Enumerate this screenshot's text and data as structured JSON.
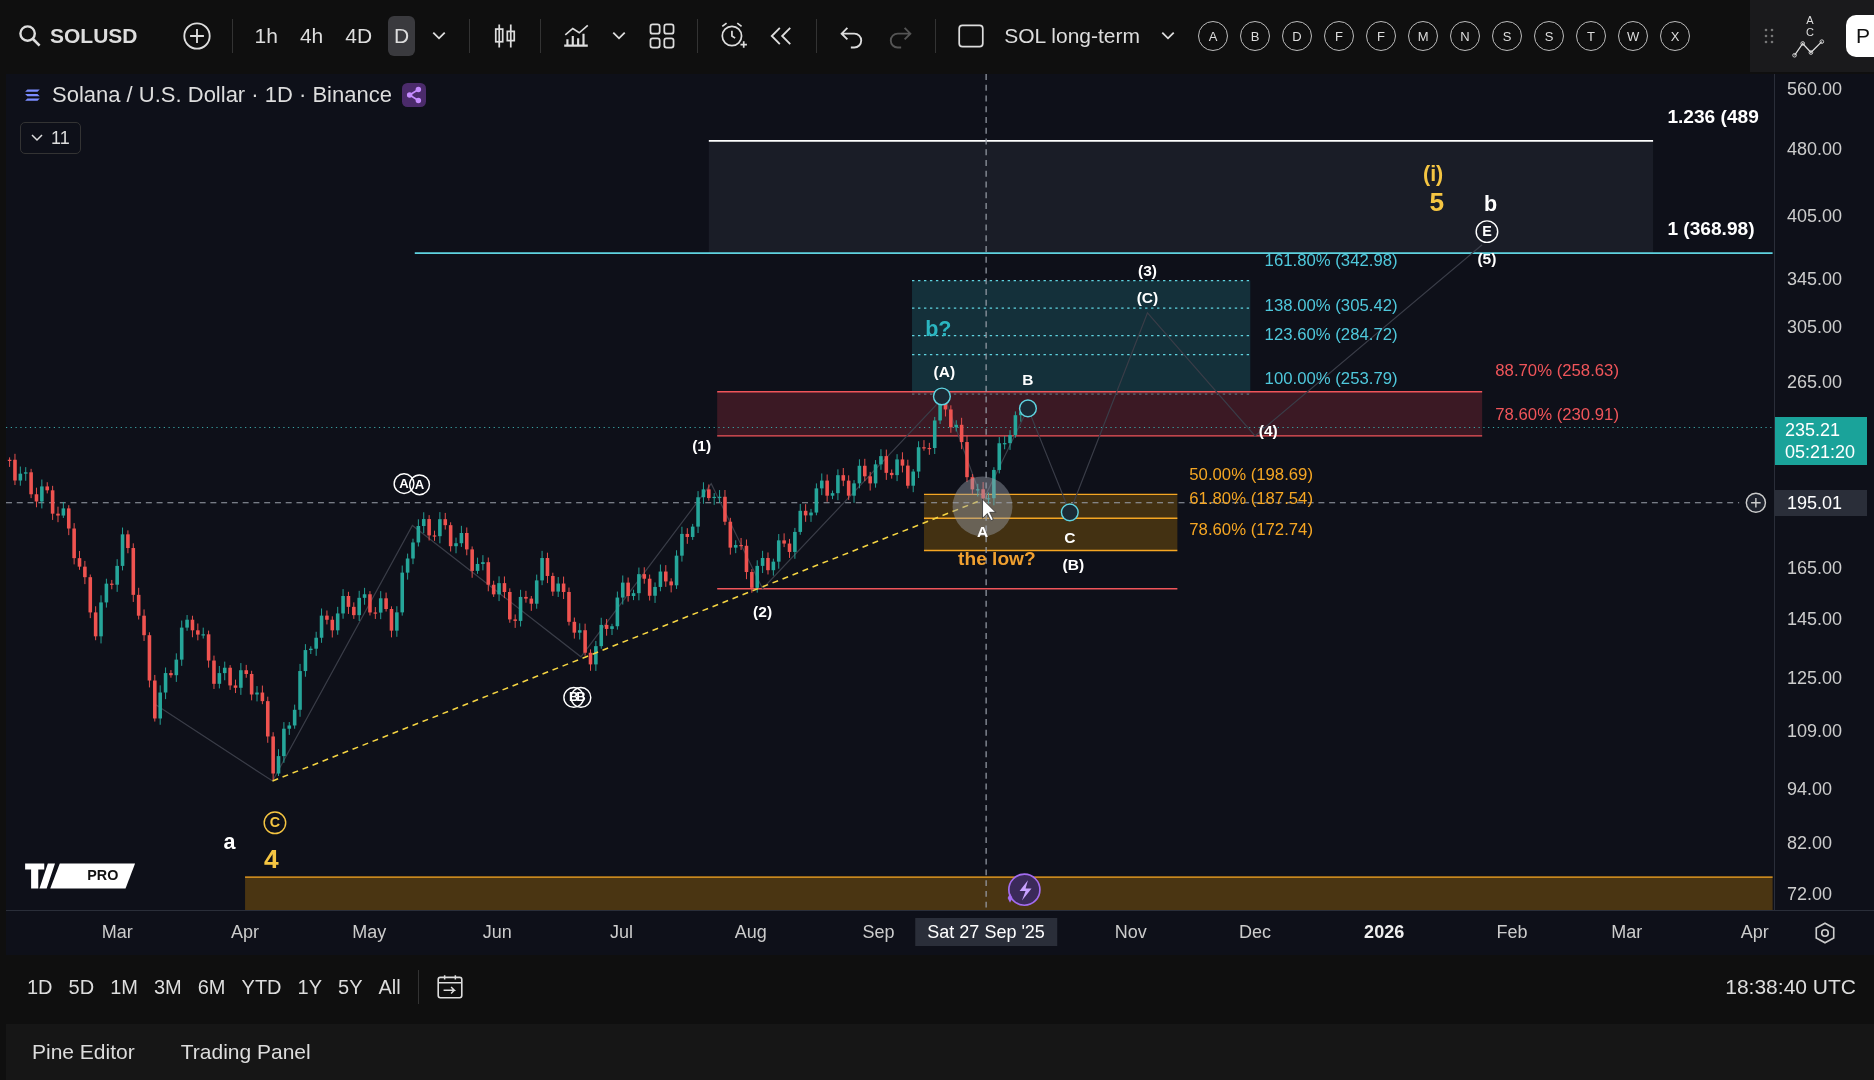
{
  "toolbar": {
    "symbol": "SOLUSD",
    "intervals": [
      {
        "label": "1h",
        "selected": false
      },
      {
        "label": "4h",
        "selected": false
      },
      {
        "label": "4D",
        "selected": false
      },
      {
        "label": "D",
        "selected": true
      }
    ],
    "history": [
      {
        "kind": "undo",
        "disabled": false
      },
      {
        "kind": "redo",
        "disabled": true
      }
    ],
    "layout_name": "SOL long-term",
    "letter_buttons": [
      "A",
      "B",
      "D",
      "F",
      "F",
      "M",
      "N",
      "S",
      "S",
      "T",
      "W",
      "X"
    ],
    "pattern_tool": "A C",
    "edge_button": "P"
  },
  "legend": {
    "title": "Solana / U.S. Dollar · 1D · Binance",
    "indicator_count": "11"
  },
  "chart": {
    "fib_labels": [
      {
        "text": "1.236 (489",
        "color": "#ffffff"
      },
      {
        "text": "1 (368.98)",
        "color": "#ffffff"
      },
      {
        "text": "161.80% (342.98)",
        "color": "#4fc8dc"
      },
      {
        "text": "138.00% (305.42)",
        "color": "#4fc8dc"
      },
      {
        "text": "123.60% (284.72)",
        "color": "#4fc8dc"
      },
      {
        "text": "100.00% (253.79)",
        "color": "#4fc8dc"
      },
      {
        "text": "88.70% (258.63)",
        "color": "#f0555a"
      },
      {
        "text": "78.60% (230.91)",
        "color": "#f0555a"
      },
      {
        "text": "50.00% (198.69)",
        "color": "#f5a623"
      },
      {
        "text": "61.80% (187.54)",
        "color": "#f5a623"
      },
      {
        "text": "78.60% (172.74)",
        "color": "#f5a623"
      }
    ],
    "wave_labels": [
      {
        "text": "(i)",
        "kind": "plain",
        "color": "#f5c542"
      },
      {
        "text": "5",
        "kind": "plain",
        "color": "#f5c542"
      },
      {
        "text": "b",
        "kind": "plain",
        "color": "#ffffff"
      },
      {
        "text": "E",
        "kind": "circled",
        "color": "#ffffff"
      },
      {
        "text": "(5)",
        "kind": "plain",
        "color": "#ffffff"
      },
      {
        "text": "(3)",
        "kind": "plain",
        "color": "#ffffff"
      },
      {
        "text": "(C)",
        "kind": "plain",
        "color": "#ffffff"
      },
      {
        "text": "b?",
        "kind": "plain",
        "color": "#2bb5c0"
      },
      {
        "text": "(A)",
        "kind": "plain",
        "color": "#ffffff"
      },
      {
        "text": "B",
        "kind": "plain",
        "color": "#ffffff"
      },
      {
        "text": "(1)",
        "kind": "plain",
        "color": "#ffffff"
      },
      {
        "text": "(4)",
        "kind": "plain",
        "color": "#ffffff"
      },
      {
        "text": "A",
        "kind": "plain",
        "color": "#ffffff"
      },
      {
        "text": "C",
        "kind": "plain",
        "color": "#ffffff"
      },
      {
        "text": "(B)",
        "kind": "plain",
        "color": "#ffffff"
      },
      {
        "text": "the low?",
        "kind": "plain",
        "color": "#f0a030"
      },
      {
        "text": "(2)",
        "kind": "plain",
        "color": "#ffffff"
      },
      {
        "text": "A",
        "kind": "circled",
        "color": "#ffffff"
      },
      {
        "text": "A",
        "kind": "circled",
        "color": "#ffffff"
      },
      {
        "text": "B",
        "kind": "circled",
        "color": "#ffffff"
      },
      {
        "text": "B",
        "kind": "circled",
        "color": "#ffffff"
      },
      {
        "text": "a",
        "kind": "plain",
        "color": "#ffffff"
      },
      {
        "text": "C",
        "kind": "circled",
        "color": "#f5c542"
      },
      {
        "text": "4",
        "kind": "plain",
        "color": "#f5c542"
      }
    ],
    "logo_badge": "PRO"
  },
  "price_axis": {
    "ticks": [
      "560.00",
      "480.00",
      "405.00",
      "345.00",
      "305.00",
      "265.00",
      "165.00",
      "145.00",
      "125.00",
      "109.00",
      "94.00",
      "82.00",
      "72.00"
    ],
    "last_price": "235.21",
    "countdown": "05:21:20",
    "crosshair_price": "195.01"
  },
  "time_axis": [
    {
      "text": "Mar",
      "kind": "month"
    },
    {
      "text": "Apr",
      "kind": "month"
    },
    {
      "text": "May",
      "kind": "month"
    },
    {
      "text": "Jun",
      "kind": "month"
    },
    {
      "text": "Jul",
      "kind": "month"
    },
    {
      "text": "Aug",
      "kind": "month"
    },
    {
      "text": "Sep",
      "kind": "month"
    },
    {
      "text": "Sat 27 Sep '25",
      "kind": "crosshair"
    },
    {
      "text": "Nov",
      "kind": "month"
    },
    {
      "text": "Dec",
      "kind": "month"
    },
    {
      "text": "2026",
      "kind": "year"
    },
    {
      "text": "Feb",
      "kind": "month"
    },
    {
      "text": "Mar",
      "kind": "month"
    },
    {
      "text": "Apr",
      "kind": "month"
    }
  ],
  "range_bar": {
    "ranges": [
      "1D",
      "5D",
      "1M",
      "3M",
      "6M",
      "YTD",
      "1Y",
      "5Y",
      "All"
    ],
    "clock": "18:38:40 UTC"
  },
  "bottom_tabs": [
    "Pine Editor",
    "Trading Panel"
  ]
}
